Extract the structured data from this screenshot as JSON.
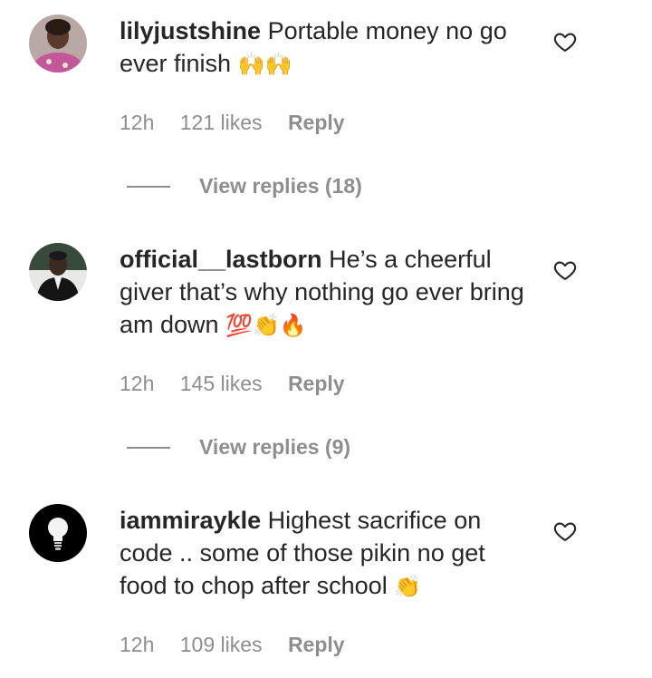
{
  "comments": [
    {
      "username": "lilyjustshine",
      "text": "Portable money no go ever finish",
      "emoji": "🙌🙌",
      "avatar_icon": "user-avatar-photo",
      "time": "12h",
      "likes": "121 likes",
      "reply_label": "Reply",
      "view_replies": "View replies (18)"
    },
    {
      "username": "official__lastborn",
      "text": "He’s a cheerful giver that’s why nothing go ever bring am down",
      "emoji": "💯👏🔥",
      "avatar_icon": "user-avatar-photo",
      "time": "12h",
      "likes": "145 likes",
      "reply_label": "Reply",
      "view_replies": "View replies (9)"
    },
    {
      "username": "iammiraykle",
      "text": "Highest sacrifice on code .. some of those pikin no get food to chop after school",
      "emoji": "👏",
      "avatar_icon": "lightbulb-avatar",
      "time": "12h",
      "likes": "109 likes",
      "reply_label": "Reply"
    }
  ],
  "colors": {
    "text": "#262626",
    "secondary": "#8e8e8e",
    "background": "#ffffff"
  }
}
